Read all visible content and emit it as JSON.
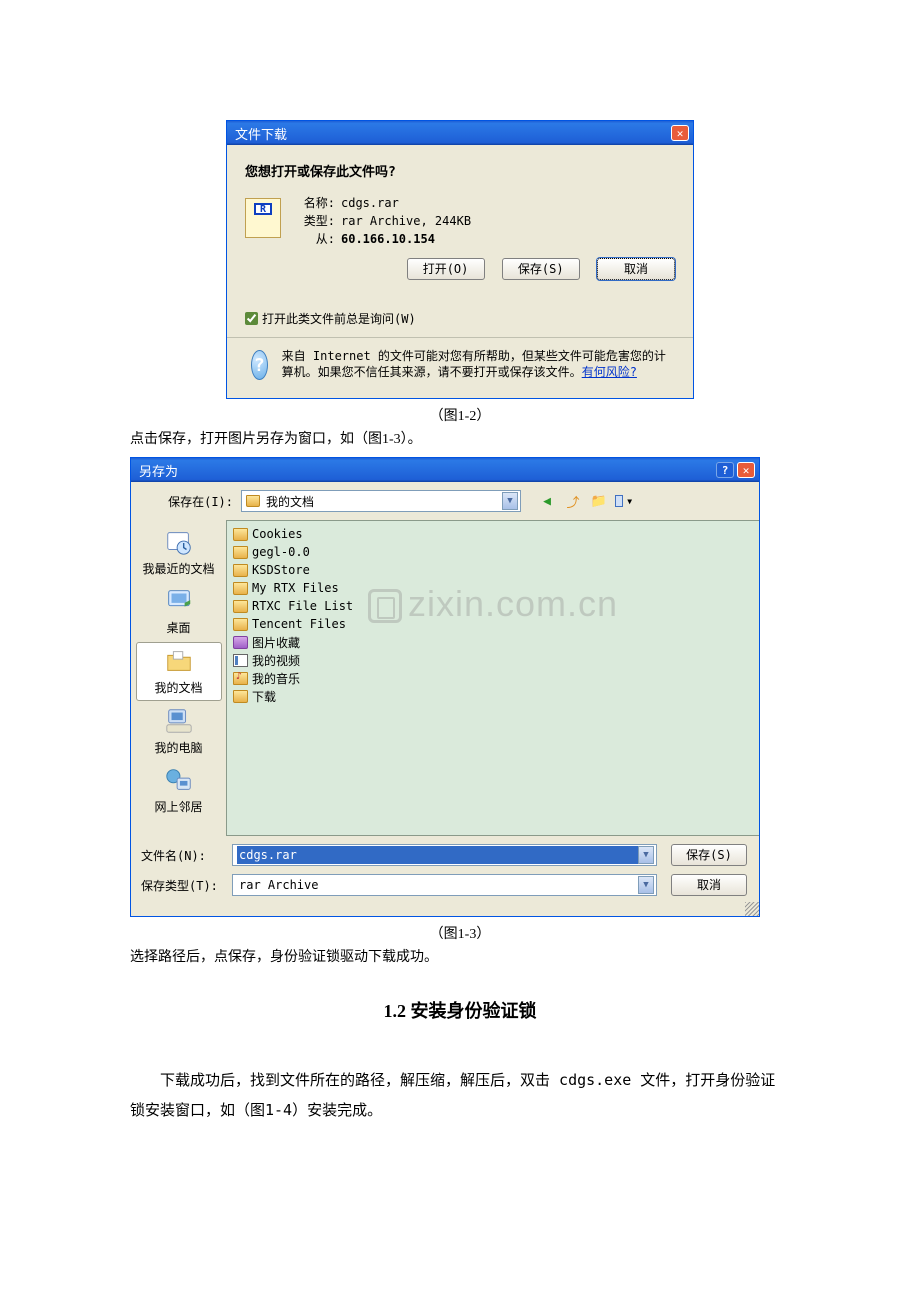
{
  "dialog1": {
    "title": "文件下载",
    "question": "您想打开或保存此文件吗?",
    "name_label": "名称:",
    "name_value": "cdgs.rar",
    "type_label": "类型:",
    "type_value": "rar Archive, 244KB",
    "from_label": "从:",
    "from_value": "60.166.10.154",
    "open_btn": "打开(O)",
    "save_btn": "保存(S)",
    "cancel_btn": "取消",
    "always_ask": "打开此类文件前总是询问(W)",
    "warning": "来自 Internet 的文件可能对您有所帮助，但某些文件可能危害您的计算机。如果您不信任其来源，请不要打开或保存该文件。",
    "warning_link": "有何风险?"
  },
  "caption1": "（图1-2）",
  "text_after1": "点击保存，打开图片另存为窗口，如（图1-3）。",
  "dialog2": {
    "title": "另存为",
    "save_in_label": "保存在(I):",
    "save_in_value": "我的文档",
    "places": {
      "recent": "我最近的文档",
      "desktop": "桌面",
      "mydocs": "我的文档",
      "mycomputer": "我的电脑",
      "network": "网上邻居"
    },
    "files": [
      {
        "icon": "folder",
        "name": "Cookies"
      },
      {
        "icon": "folder",
        "name": "gegl-0.0"
      },
      {
        "icon": "folder",
        "name": "KSDStore"
      },
      {
        "icon": "folder",
        "name": "My RTX Files"
      },
      {
        "icon": "folder",
        "name": "RTXC File List"
      },
      {
        "icon": "folder",
        "name": "Tencent Files"
      },
      {
        "icon": "purple",
        "name": "图片收藏"
      },
      {
        "icon": "video",
        "name": "我的视频"
      },
      {
        "icon": "music",
        "name": "我的音乐"
      },
      {
        "icon": "folder",
        "name": "下载"
      }
    ],
    "filename_label": "文件名(N):",
    "filename_value": "cdgs.rar",
    "filetype_label": "保存类型(T):",
    "filetype_value": "rar Archive",
    "save_btn": "保存(S)",
    "cancel_btn": "取消"
  },
  "watermark": "zixin.com.cn",
  "caption2": "（图1-3）",
  "text_after2": "选择路径后，点保存，身份验证锁驱动下载成功。",
  "section": {
    "heading": "1.2  安装身份验证锁",
    "body": "下载成功后，找到文件所在的路径，解压缩，解压后，双击 cdgs.exe 文件，打开身份验证锁安装窗口，如（图1-4）安装完成。"
  }
}
